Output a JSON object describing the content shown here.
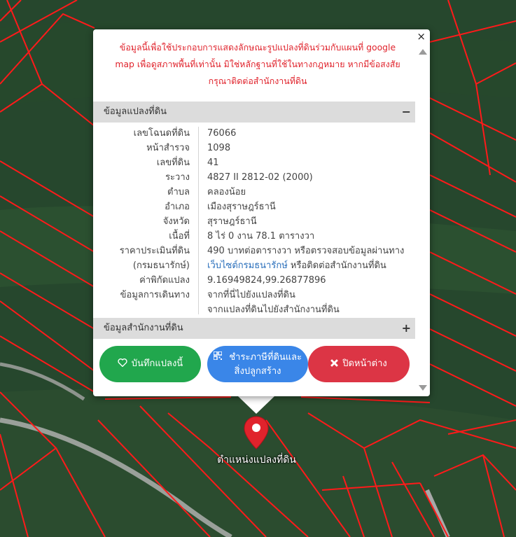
{
  "notice_lines": [
    "ข้อมูลนี้เพื่อใช้ประกอบการแสดงลักษณะรูปแปลงที่ดินร่วมกับแผนที่ google",
    "map เพื่อดูสภาพพื้นที่เท่านั้น มิใช่หลักฐานที่ใช้ในทางกฎหมาย หากมีข้อสงสัย",
    "กรุณาติดต่อสำนักงานที่ดิน"
  ],
  "section_land": {
    "title": "ข้อมูลแปลงที่ดิน",
    "toggle": "−"
  },
  "section_office": {
    "title": "ข้อมูลสำนักงานที่ดิน",
    "toggle": "+"
  },
  "close_symbol": "×",
  "fields": [
    {
      "label": "เลขโฉนดที่ดิน",
      "value": "76066"
    },
    {
      "label": "หน้าสำรวจ",
      "value": "1098"
    },
    {
      "label": "เลขที่ดิน",
      "value": "41"
    },
    {
      "label": "ระวาง",
      "value": "4827 II 2812-02 (2000)"
    },
    {
      "label": "ตำบล",
      "value": "คลองน้อย"
    },
    {
      "label": "อำเภอ",
      "value": "เมืองสุราษฎร์ธานี"
    },
    {
      "label": "จังหวัด",
      "value": "สุราษฎร์ธานี"
    },
    {
      "label": "เนื้อที่",
      "value": "8 ไร่ 0 งาน 78.1 ตารางวา"
    },
    {
      "label": "ราคาประเมินที่ดิน",
      "value": "490 บาทต่อตารางวา หรือตรวจสอบข้อมูลผ่านทาง"
    }
  ],
  "price_row2": {
    "label": "(กรมธนารักษ์)",
    "link": "เว็บไซต์กรมธนารักษ์",
    "suffix": " หรือติดต่อสำนักงานที่ดิน"
  },
  "coord_row": {
    "label": "ค่าพิกัดแปลง",
    "value": "9.16949824,99.26877896"
  },
  "travel_row": {
    "label": "ข้อมูลการเดินทาง",
    "link1": "จากที่นี่ไปยังแปลงที่ดิน",
    "link2": "จากแปลงที่ดินไปยังสำนักงานที่ดิน"
  },
  "buttons": {
    "save": "บันทึกแปลงนี้",
    "tax_line1": "ชำระภาษีที่ดินและ",
    "tax_line2": "สิ่งปลูกสร้าง",
    "close": "ปิดหน้าต่าง"
  },
  "marker_label": "ตำแหน่งแปลงที่ดิน",
  "icons": {
    "save": "heart-icon",
    "tax": "qr-code-icon",
    "close": "x-icon",
    "marker": "map-pin-icon"
  },
  "colors": {
    "notice": "#e0232c",
    "save": "#21a74d",
    "tax": "#3a86e8",
    "close": "#dc3545",
    "parcel_lines": "#ff1a1a",
    "link": "#2a6fbb"
  }
}
